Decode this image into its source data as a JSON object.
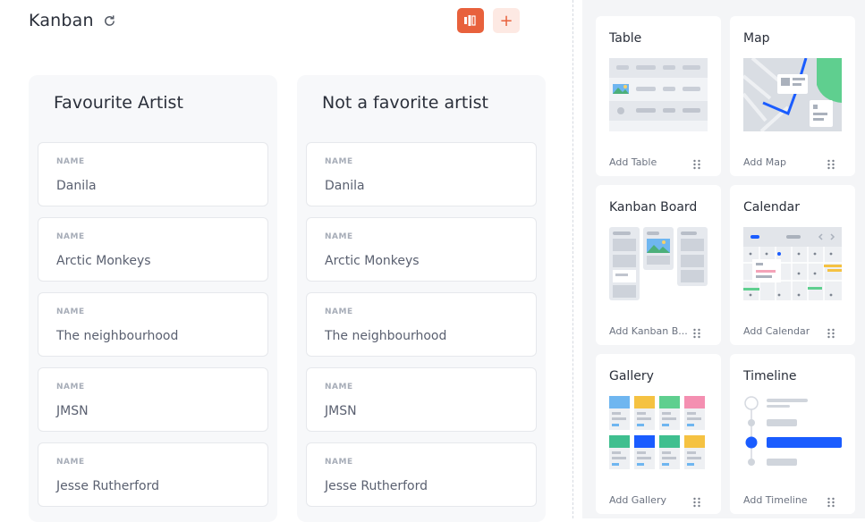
{
  "header": {
    "title": "Kanban"
  },
  "columns": [
    {
      "title": "Favourite Artist",
      "cards": [
        {
          "label": "NAME",
          "value": "Danila"
        },
        {
          "label": "NAME",
          "value": "Arctic Monkeys"
        },
        {
          "label": "NAME",
          "value": "The neighbourhood"
        },
        {
          "label": "NAME",
          "value": "JMSN"
        },
        {
          "label": "NAME",
          "value": "Jesse Rutherford"
        }
      ]
    },
    {
      "title": "Not a favorite artist",
      "cards": [
        {
          "label": "NAME",
          "value": "Danila"
        },
        {
          "label": "NAME",
          "value": "Arctic Monkeys"
        },
        {
          "label": "NAME",
          "value": "The neighbourhood"
        },
        {
          "label": "NAME",
          "value": "JMSN"
        },
        {
          "label": "NAME",
          "value": "Jesse Rutherford"
        }
      ]
    }
  ],
  "widgets": [
    {
      "title": "Table",
      "add": "Add Table",
      "icon": "table-preview-icon"
    },
    {
      "title": "Map",
      "add": "Add Map",
      "icon": "map-preview-icon"
    },
    {
      "title": "Kanban Board",
      "add": "Add Kanban B...",
      "icon": "kanban-preview-icon"
    },
    {
      "title": "Calendar",
      "add": "Add Calendar",
      "icon": "calendar-preview-icon"
    },
    {
      "title": "Gallery",
      "add": "Add Gallery",
      "icon": "gallery-preview-icon"
    },
    {
      "title": "Timeline",
      "add": "Add Timeline",
      "icon": "timeline-preview-icon"
    }
  ],
  "colors": {
    "accent": "#e8613c",
    "accent_light": "#fde9e3",
    "blue": "#1a5cff",
    "green": "#5fcf8f"
  },
  "icons": {
    "refresh": "refresh-icon",
    "view": "board-view-icon",
    "add": "plus-icon",
    "drag": "drag-handle-icon"
  },
  "buttons": {
    "add_symbol": "+"
  }
}
